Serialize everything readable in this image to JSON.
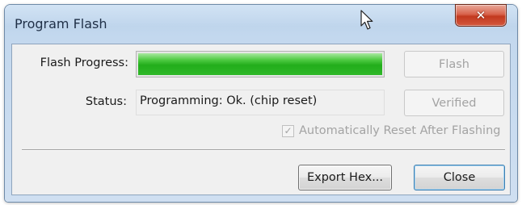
{
  "window": {
    "title": "Program Flash",
    "close_glyph": "✕"
  },
  "colors": {
    "progress_green": "#2fb829",
    "close_red": "#c2391f"
  },
  "progress": {
    "label": "Flash Progress:",
    "value_percent": 100
  },
  "status": {
    "label": "Status:",
    "value": "Programming: Ok. (chip reset)"
  },
  "buttons": {
    "flash": "Flash",
    "verified": "Verified",
    "export_hex": "Export Hex...",
    "close": "Close"
  },
  "auto_reset": {
    "label": "Automatically Reset After Flashing",
    "checked": true,
    "enabled": false
  },
  "icons": {
    "close": "close-icon",
    "cursor": "mouse-pointer-icon",
    "check": "checkmark-icon"
  }
}
